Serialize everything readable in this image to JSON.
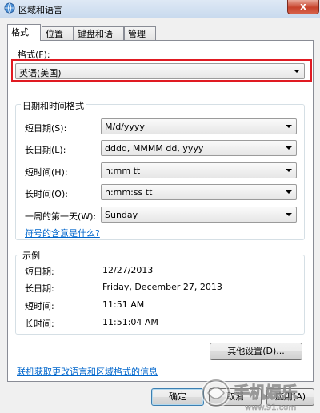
{
  "window": {
    "title": "区域和语言",
    "close_label": "x"
  },
  "tabs": [
    {
      "label": "格式"
    },
    {
      "label": "位置"
    },
    {
      "label": "键盘和语言"
    },
    {
      "label": "管理"
    }
  ],
  "format": {
    "label": "格式(F):",
    "value": "英语(美国)"
  },
  "datetime_group": {
    "title": "日期和时间格式",
    "rows": [
      {
        "label": "短日期(S):",
        "value": "M/d/yyyy"
      },
      {
        "label": "长日期(L):",
        "value": "dddd, MMMM dd, yyyy"
      },
      {
        "label": "短时间(H):",
        "value": "h:mm tt"
      },
      {
        "label": "长时间(O):",
        "value": "h:mm:ss tt"
      },
      {
        "label": "一周的第一天(W):",
        "value": "Sunday"
      }
    ],
    "symbol_link": "符号的含意是什么?"
  },
  "example_group": {
    "title": "示例",
    "rows": [
      {
        "label": "短日期:",
        "value": "12/27/2013"
      },
      {
        "label": "长日期:",
        "value": "Friday, December 27, 2013"
      },
      {
        "label": "短时间:",
        "value": "11:51 AM"
      },
      {
        "label": "长时间:",
        "value": "11:51:04 AM"
      }
    ]
  },
  "other_settings_button": "其他设置(D)...",
  "online_link": "联机获取更改语言和区域格式的信息",
  "buttons": {
    "ok": "确定",
    "cancel": "取消",
    "apply": "应用(A)"
  },
  "watermark": {
    "text": "手机娱乐",
    "url_text": "www.91.com"
  },
  "colors": {
    "highlight": "#e01a22",
    "link": "#0066cc"
  }
}
